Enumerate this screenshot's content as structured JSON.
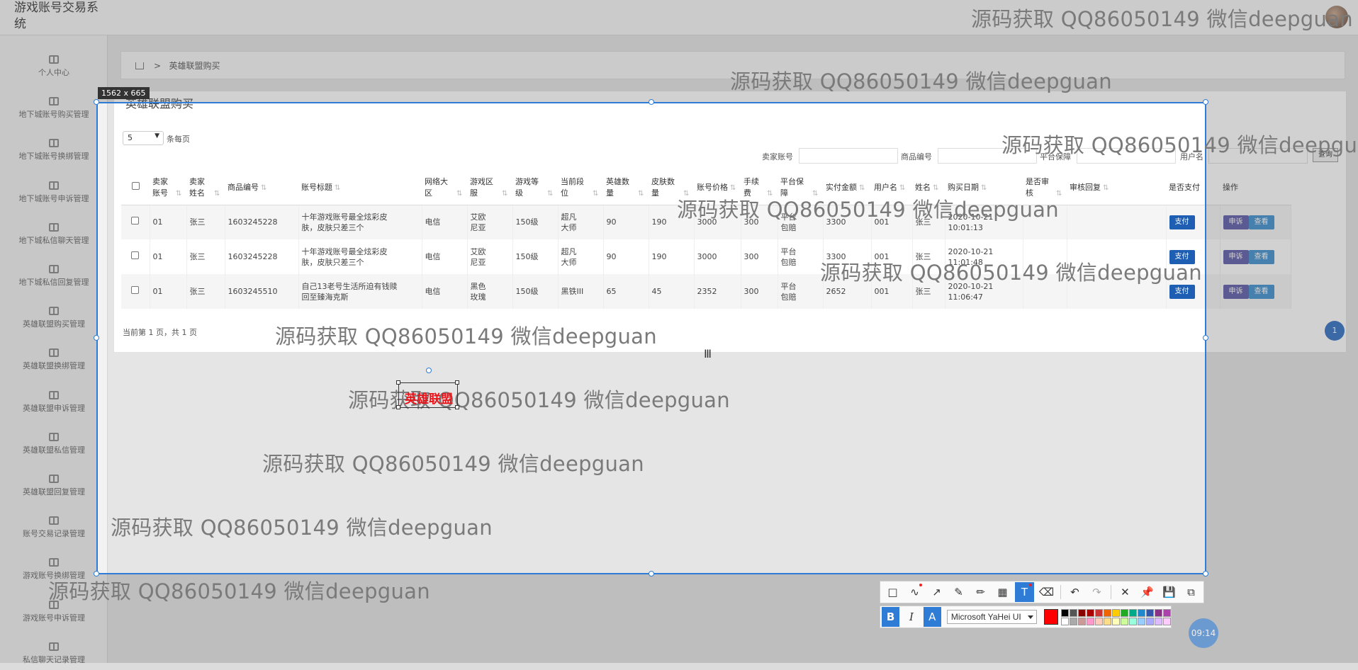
{
  "app": {
    "title": "游戏账号交易系统"
  },
  "sidebar": {
    "items": [
      {
        "label": "个人中心"
      },
      {
        "label": "地下城账号购买管理"
      },
      {
        "label": "地下城账号换绑管理"
      },
      {
        "label": "地下城账号申诉管理"
      },
      {
        "label": "地下城私信聊天管理"
      },
      {
        "label": "地下城私信回复管理"
      },
      {
        "label": "英雄联盟购买管理"
      },
      {
        "label": "英雄联盟换绑管理"
      },
      {
        "label": "英雄联盟申诉管理"
      },
      {
        "label": "英雄联盟私信管理"
      },
      {
        "label": "英雄联盟回复管理"
      },
      {
        "label": "账号交易记录管理"
      },
      {
        "label": "游戏账号换绑管理"
      },
      {
        "label": "游戏账号申诉管理"
      },
      {
        "label": "私信聊天记录管理"
      }
    ]
  },
  "breadcrumb": {
    "current": "英雄联盟购买"
  },
  "card": {
    "title": "英雄联盟购买"
  },
  "pagesize": {
    "value": "5",
    "label": "条每页"
  },
  "search": {
    "seller_label": "卖家账号",
    "product_label": "商品编号",
    "platform_label": "平台保障",
    "user_label": "用户名",
    "button": "查询"
  },
  "table": {
    "headers": [
      "卖家账号",
      "卖家姓名",
      "商品编号",
      "账号标题",
      "网络大区",
      "游戏区服",
      "游戏等级",
      "当前段位",
      "英雄数量",
      "皮肤数量",
      "账号价格",
      "手续费",
      "平台保障",
      "实付金额",
      "用户名",
      "姓名",
      "购买日期",
      "是否审核",
      "审核回复",
      "是否支付",
      "操作"
    ],
    "rows": [
      [
        "01",
        "张三",
        "1603245228",
        "十年游戏账号最全炫彩皮肤，皮肤只差三个",
        "电信",
        "艾欧尼亚",
        "150级",
        "超凡大师",
        "90",
        "190",
        "3000",
        "300",
        "平台包赔",
        "3300",
        "001",
        "张三",
        "2020-10-21 10:01:13",
        "",
        "",
        "",
        ""
      ],
      [
        "01",
        "张三",
        "1603245228",
        "十年游戏账号最全炫彩皮肤，皮肤只差三个",
        "电信",
        "艾欧尼亚",
        "150级",
        "超凡大师",
        "90",
        "190",
        "3000",
        "300",
        "平台包赔",
        "3300",
        "001",
        "张三",
        "2020-10-21 11:01:48",
        "",
        "",
        "",
        ""
      ],
      [
        "01",
        "张三",
        "1603245510",
        "自己13老号生活所迫有钱赎回至臻海克斯",
        "电信",
        "黑色玫瑰",
        "150级",
        "黑铁III",
        "65",
        "45",
        "2352",
        "300",
        "平台包赔",
        "2652",
        "001",
        "张三",
        "2020-10-21 11:06:47",
        "",
        "",
        "",
        ""
      ]
    ],
    "actions": {
      "pay": "支付",
      "apply": "申诉",
      "view": "查看"
    }
  },
  "pager": {
    "summary": "当前第 1 页，共 1 页",
    "page": "1"
  },
  "capture": {
    "size": "1562 x 665",
    "text_box": "英雄联盟",
    "font": "Microsoft YaHei UI",
    "clock": "09:14"
  },
  "watermark": "源码获取 QQ86050149 微信deepguan",
  "colors": {
    "selection": "#2e7cd6",
    "accent": "#2f6fc4",
    "text_red": "#e8141a"
  }
}
